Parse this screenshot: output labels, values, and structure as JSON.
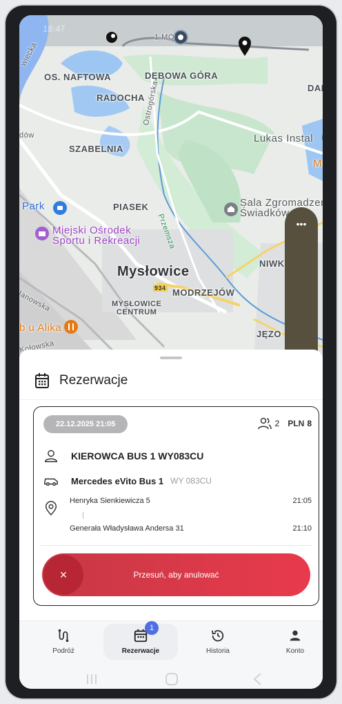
{
  "status_bar": {
    "time": "18:47"
  },
  "map": {
    "labels": {
      "os_naftowa": "OS. NAFTOWA",
      "debowa_gora": "DĘBOWA GÓRA",
      "radocha": "RADOCHA",
      "ostrogorska": "Ostrogórska",
      "szabelnia": "SZABELNIA",
      "lukas": "Lukas Instal",
      "piasek": "PIASEK",
      "park": "Park",
      "sala": "Sala Zgromadzeń\nŚwiadków",
      "mos": "Miejski Ośrodek\nSportu i Rekreacji",
      "przemsza": "Przemsza",
      "myslowice": "Mysłowice",
      "road_934": "934",
      "modrzejow": "MODRZEJÓW",
      "centrum": "MYSŁOWICE\nCENTRUM",
      "alika": "b u Alika",
      "janowska": "Janowska",
      "jezo": "JĘZO",
      "niwk": "NIWK",
      "mc": "Mc",
      "dan": "DAŃ",
      "wiecka": "wiecka",
      "dow": "dów",
      "kolowska": "Kołowska",
      "mo": "1 MO"
    }
  },
  "sheet": {
    "title": "Rezerwacje",
    "reservation": {
      "datetime": "22.12.2025 21:05",
      "passengers": "2",
      "currency": "PLN",
      "price": "8",
      "driver": "KIEROWCA BUS 1 WY083CU",
      "vehicle_name": "Mercedes eVito Bus 1",
      "vehicle_plate": "WY 083CU",
      "pickup_address": "Henryka Sienkiewicza 5",
      "pickup_time": "21:05",
      "dropoff_address": "Generała Władysława Andersa 31",
      "dropoff_time": "21:10",
      "cancel_slider_label": "Przesuń, aby anulować",
      "cancel_icon": "×"
    }
  },
  "bottom_nav": {
    "tabs": [
      {
        "label": "Podróż",
        "icon": "route-icon"
      },
      {
        "label": "Rezerwacje",
        "icon": "calendar-icon",
        "badge": "1",
        "active": true
      },
      {
        "label": "Historia",
        "icon": "history-icon"
      },
      {
        "label": "Konto",
        "icon": "account-icon"
      }
    ]
  },
  "float_control": {
    "more": "•••"
  },
  "colors": {
    "accent": "#e83a4c",
    "badge": "#4f6fe3",
    "float_bg": "#57503f"
  }
}
